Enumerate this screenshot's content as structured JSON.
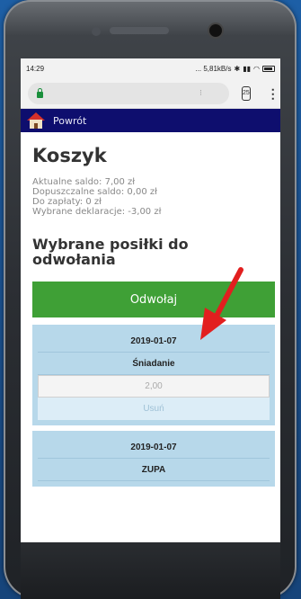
{
  "status": {
    "time": "14:29",
    "network": "... 5,81kB/s",
    "tabs_count": "25"
  },
  "nav": {
    "back_label": "Powrót"
  },
  "cart": {
    "title": "Koszyk",
    "info_lines": [
      "Aktualne saldo: 7,00 zł",
      "Dopuszczalne saldo: 0,00 zł",
      "Do zapłaty: 0 zł",
      "Wybrane deklaracje: -3,00 zł"
    ],
    "section_title": "Wybrane posiłki do odwołania",
    "cancel_button": "Odwołaj",
    "meals": [
      {
        "date": "2019-01-07",
        "name": "Śniadanie",
        "price": "2,00",
        "remove": "Usuń"
      },
      {
        "date": "2019-01-07",
        "name": "ZUPA"
      }
    ]
  },
  "colors": {
    "navbar": "#0e0e6e",
    "button": "#3fa036",
    "meal_bg": "#b7d8ea",
    "arrow": "#e21f1f"
  }
}
